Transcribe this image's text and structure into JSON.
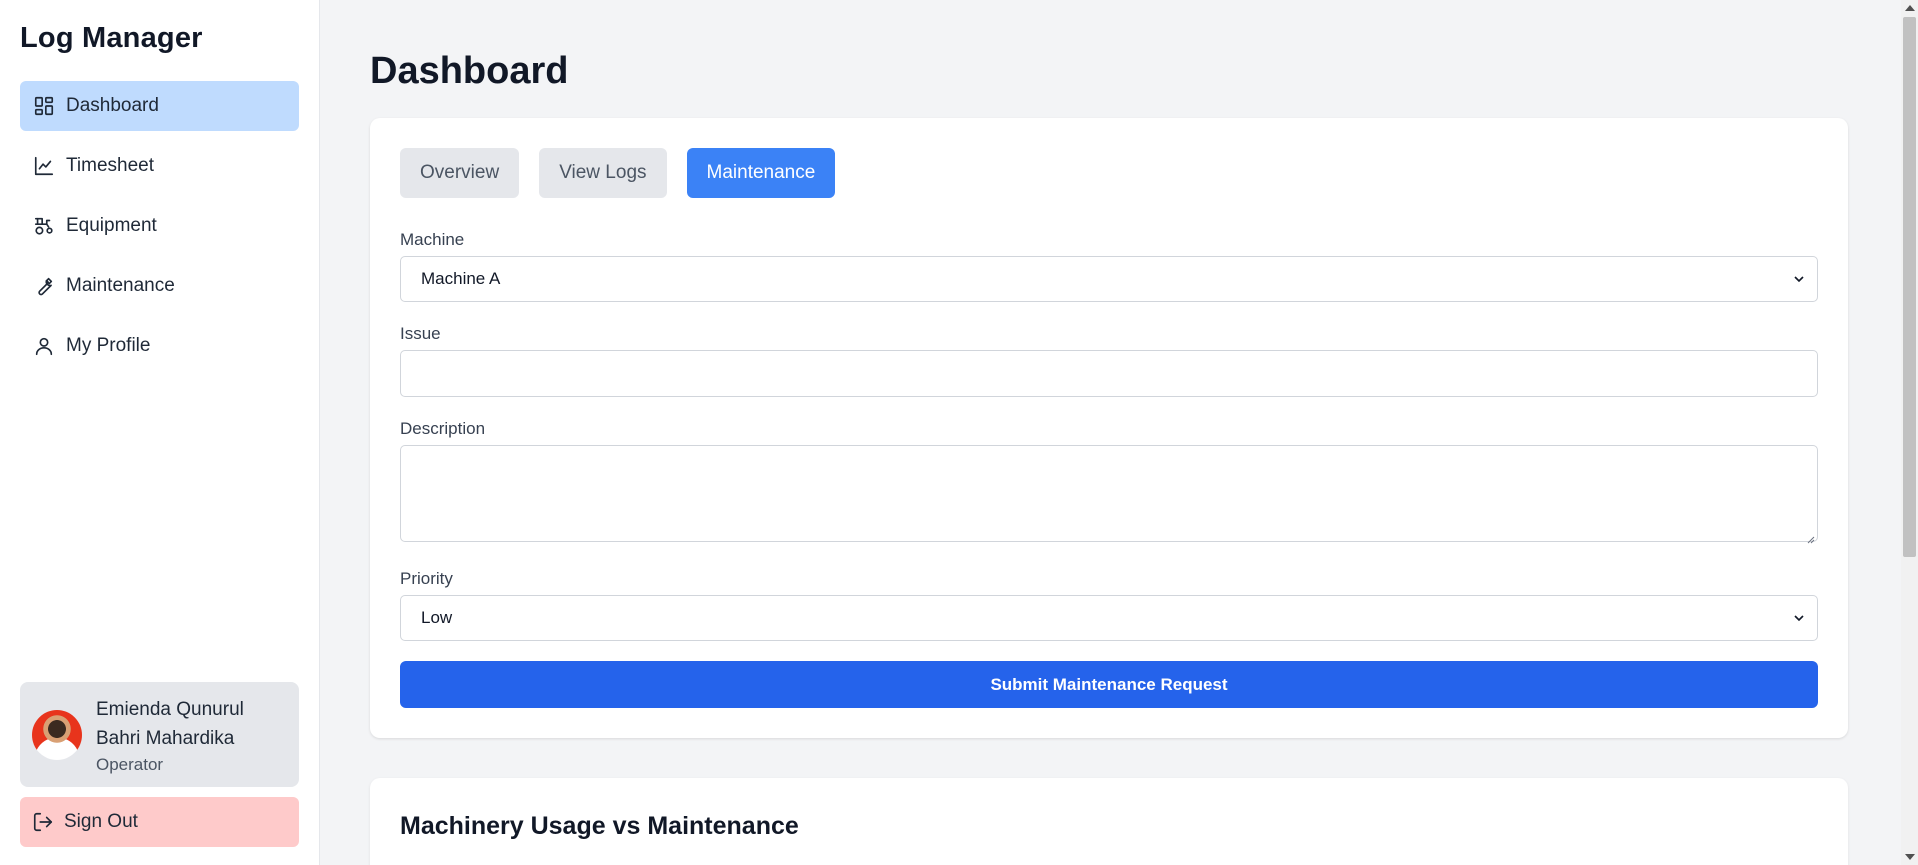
{
  "app": {
    "title": "Log Manager"
  },
  "sidebar": {
    "items": [
      {
        "label": "Dashboard",
        "icon": "dashboard-icon",
        "active": true
      },
      {
        "label": "Timesheet",
        "icon": "chart-line-icon",
        "active": false
      },
      {
        "label": "Equipment",
        "icon": "tractor-icon",
        "active": false
      },
      {
        "label": "Maintenance",
        "icon": "wrench-icon",
        "active": false
      },
      {
        "label": "My Profile",
        "icon": "user-icon",
        "active": false
      }
    ],
    "user": {
      "name": "Emienda Qunurul Bahri Mahardika",
      "role": "Operator"
    },
    "signout_label": "Sign Out"
  },
  "main": {
    "title": "Dashboard",
    "tabs": [
      {
        "label": "Overview",
        "active": false
      },
      {
        "label": "View Logs",
        "active": false
      },
      {
        "label": "Maintenance",
        "active": true
      }
    ],
    "form": {
      "machine_label": "Machine",
      "machine_value": "Machine A",
      "issue_label": "Issue",
      "issue_value": "",
      "description_label": "Description",
      "description_value": "",
      "priority_label": "Priority",
      "priority_value": "Low",
      "submit_label": "Submit Maintenance Request"
    },
    "chart_card_title": "Machinery Usage vs Maintenance"
  },
  "colors": {
    "active_nav_bg": "#bfdbfe",
    "active_tab_bg": "#3b82f6",
    "submit_bg": "#2563eb",
    "signout_bg": "#fecaca"
  }
}
